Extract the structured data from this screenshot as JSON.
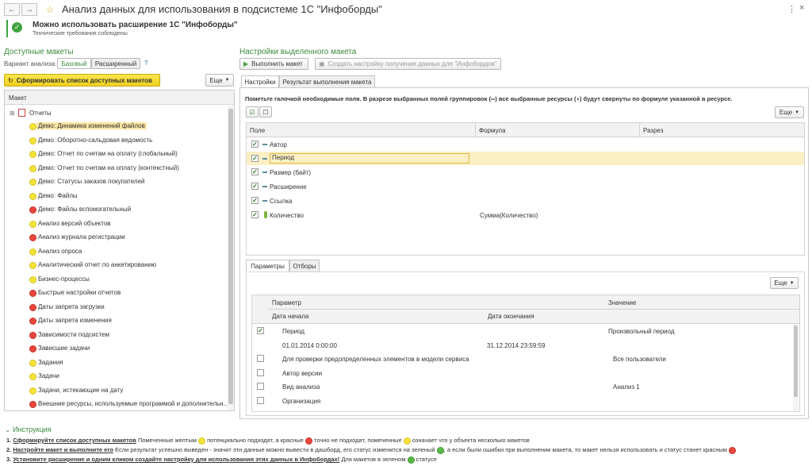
{
  "window": {
    "title": "Анализ данных для использования в подсистеме 1С \"Инфоборды\""
  },
  "notice": {
    "title": "Можно использовать расширение 1С \"Инфоборды\"",
    "subtitle": "Технические требования соблюдены"
  },
  "left": {
    "section_title": "Доступные макеты",
    "variant_label": "Вариант анализа:",
    "variant_basic": "Базовый",
    "variant_extended": "Расширенный",
    "help": "?",
    "generate_button": "Сформировать список доступных макетов",
    "more_button": "Еще",
    "column_header": "Макет",
    "root_label": "Отчеты",
    "items": [
      {
        "label": "Демо: Динамика изменений файлов",
        "status": "y"
      },
      {
        "label": "Демо: Оборотно-сальдовая ведомость",
        "status": "y"
      },
      {
        "label": "Демо: Отчет по счетам на оплату (глобальный)",
        "status": "y"
      },
      {
        "label": "Демо: Отчет по счетам на оплату (контекстный)",
        "status": "y"
      },
      {
        "label": "Демо: Статусы заказов покупателей",
        "status": "y"
      },
      {
        "label": "Демо: Файлы",
        "status": "y"
      },
      {
        "label": "Демо: Файлы вспомогательный",
        "status": "r"
      },
      {
        "label": "Анализ версий объектов",
        "status": "y"
      },
      {
        "label": "Анализ журнала регистрации",
        "status": "r"
      },
      {
        "label": "Анализ опроса",
        "status": "y"
      },
      {
        "label": "Аналитический отчет по анкетированию",
        "status": "y"
      },
      {
        "label": "Бизнес-процессы",
        "status": "y"
      },
      {
        "label": "Быстрые настройки отчетов",
        "status": "r"
      },
      {
        "label": "Даты запрета загрузки",
        "status": "r"
      },
      {
        "label": "Даты запрета изменения",
        "status": "r"
      },
      {
        "label": "Зависимости подсистем",
        "status": "r"
      },
      {
        "label": "Зависшие задачи",
        "status": "r"
      },
      {
        "label": "Задания",
        "status": "y"
      },
      {
        "label": "Задачи",
        "status": "y"
      },
      {
        "label": "Задачи, истекающие на дату",
        "status": "y"
      },
      {
        "label": "Внешние ресурсы, используемые программой и дополнительн...",
        "status": "r"
      }
    ]
  },
  "right": {
    "section_title": "Настройки выделенного макета",
    "run_button": "Выполнить макет",
    "create_button": "Создать настройку получения данных для \"Инфобордов\"",
    "tab_settings": "Настройки",
    "tab_result": "Результат выполнения макета",
    "hint_text": "Пометьте галочкой необходимые поля. В разрезе выбранных полей группировок (═) все выбранные ресурсы (◖) будут свернуты по формуле указанной в ресурсе.",
    "more_button": "Еще",
    "fields_headers": {
      "field": "Поле",
      "formula": "Формула",
      "slice": "Разрез"
    },
    "fields": [
      {
        "name": "Автор",
        "formula": "",
        "kind": "group"
      },
      {
        "name": "Период",
        "formula": "",
        "kind": "group"
      },
      {
        "name": "Размер (байт)",
        "formula": "",
        "kind": "group"
      },
      {
        "name": "Расширение",
        "formula": "",
        "kind": "group"
      },
      {
        "name": "Ссылка",
        "formula": "",
        "kind": "group"
      },
      {
        "name": "Количество",
        "formula": "Сумма(Количество)",
        "kind": "resource"
      }
    ],
    "tab_params": "Параметры",
    "tab_filters": "Отборы",
    "params_more": "Еще",
    "params_headers": {
      "param": "Параметр",
      "value": "Значение",
      "start": "Дата начала",
      "end": "Дата окончания"
    },
    "params": [
      {
        "name": "Период",
        "value": "Произвольный период",
        "checked": true
      },
      {
        "name": "Для проверки предопределенных элементов в модели сервиса",
        "value": "Все пользователи",
        "checked": false
      },
      {
        "name": "Автор версии",
        "value": "",
        "checked": false
      },
      {
        "name": "Вид анализа",
        "value": "Анализ 1",
        "checked": false
      },
      {
        "name": "Организация",
        "value": "",
        "checked": false
      }
    ],
    "period_start": "01.01.2014 0:00:00",
    "period_end": "31.12.2014 23:59:59"
  },
  "instructions": {
    "title": "Инструкция",
    "step1_num": "1.",
    "step1_link": "Сформируйте список доступных макетов",
    "step1_a": "Помеченные желтым",
    "step1_b": "потенциально подходят, а красные",
    "step1_c": "точно не подходят, помеченные",
    "step1_d": "означает что у объекта несколько макетов",
    "step2_num": "2.",
    "step2_link": "Настройте макет и выполните его",
    "step2_a": "Если результат успешно выведен - значит эти данные можно вывести в дашборд, его статус изменится на зеленый",
    "step2_b": ", а если были ошибки при выполнении макета, то макет нельзя использовать и статус станет красным",
    "step3_num": "3.",
    "step3_link": "Установите расширение и одним кликом создайте настройку для использования этих данных в Инфобордах!",
    "step3_a": "Для макетов в зеленом",
    "step3_b": "статусе"
  },
  "colors": {
    "accent_green": "#3b8a3b",
    "yellow": "#f3e33a",
    "red": "#e7463d",
    "green": "#57b947",
    "selection": "#fbe6a4"
  }
}
